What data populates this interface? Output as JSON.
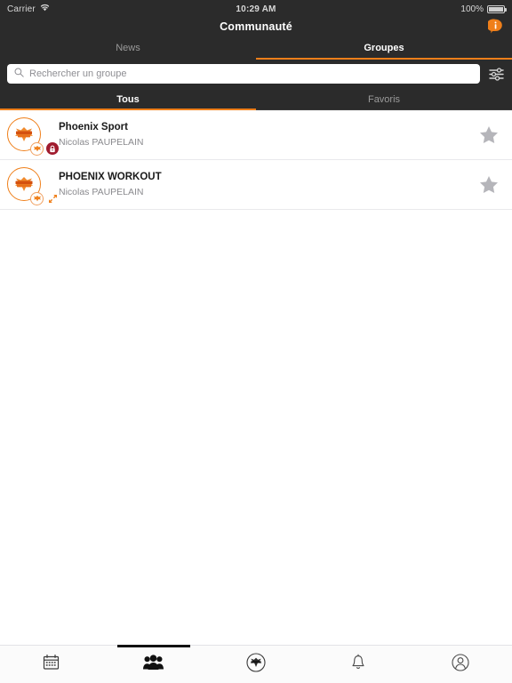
{
  "statusbar": {
    "carrier": "Carrier",
    "wifi_icon": "wifi-icon",
    "time": "10:29 AM",
    "battery_percent": "100%",
    "battery_icon": "battery-full-icon"
  },
  "navbar": {
    "title": "Communauté",
    "info_icon": "info-bubble-icon"
  },
  "segments": [
    {
      "label": "News",
      "active": false
    },
    {
      "label": "Groupes",
      "active": true
    }
  ],
  "search": {
    "placeholder": "Rechercher un groupe",
    "value": "",
    "search_icon": "search-icon",
    "filter_icon": "sliders-filter-icon"
  },
  "subtabs": [
    {
      "label": "Tous",
      "active": true
    },
    {
      "label": "Favoris",
      "active": false
    }
  ],
  "groups": [
    {
      "name": "Phoenix Sport",
      "owner": "Nicolas PAUPELAIN",
      "avatar_icon": "phoenix-sport-logo",
      "badge_primary_icon": "phoenix-badge-icon",
      "badge_secondary_icon": "lock-icon",
      "badge_secondary_type": "lock",
      "favorite_icon": "star-icon",
      "favorite": false
    },
    {
      "name": "PHOENIX WORKOUT",
      "owner": "Nicolas PAUPELAIN",
      "avatar_icon": "phoenix-workout-logo",
      "badge_primary_icon": "phoenix-badge-icon",
      "badge_secondary_icon": "expand-arrows-icon",
      "badge_secondary_type": "arrows",
      "favorite_icon": "star-icon",
      "favorite": false
    }
  ],
  "tabbar": [
    {
      "icon": "calendar-icon",
      "active": false
    },
    {
      "icon": "people-group-icon",
      "active": true
    },
    {
      "icon": "phoenix-logo-icon",
      "active": false
    },
    {
      "icon": "bell-icon",
      "active": false
    },
    {
      "icon": "profile-icon",
      "active": false
    }
  ],
  "colors": {
    "accent_orange": "#ef7f1a",
    "header_dark": "#2b2b2b",
    "lock_red": "#a01b2e",
    "star_gray": "#b5b5ba",
    "body_white": "#ffffff"
  }
}
